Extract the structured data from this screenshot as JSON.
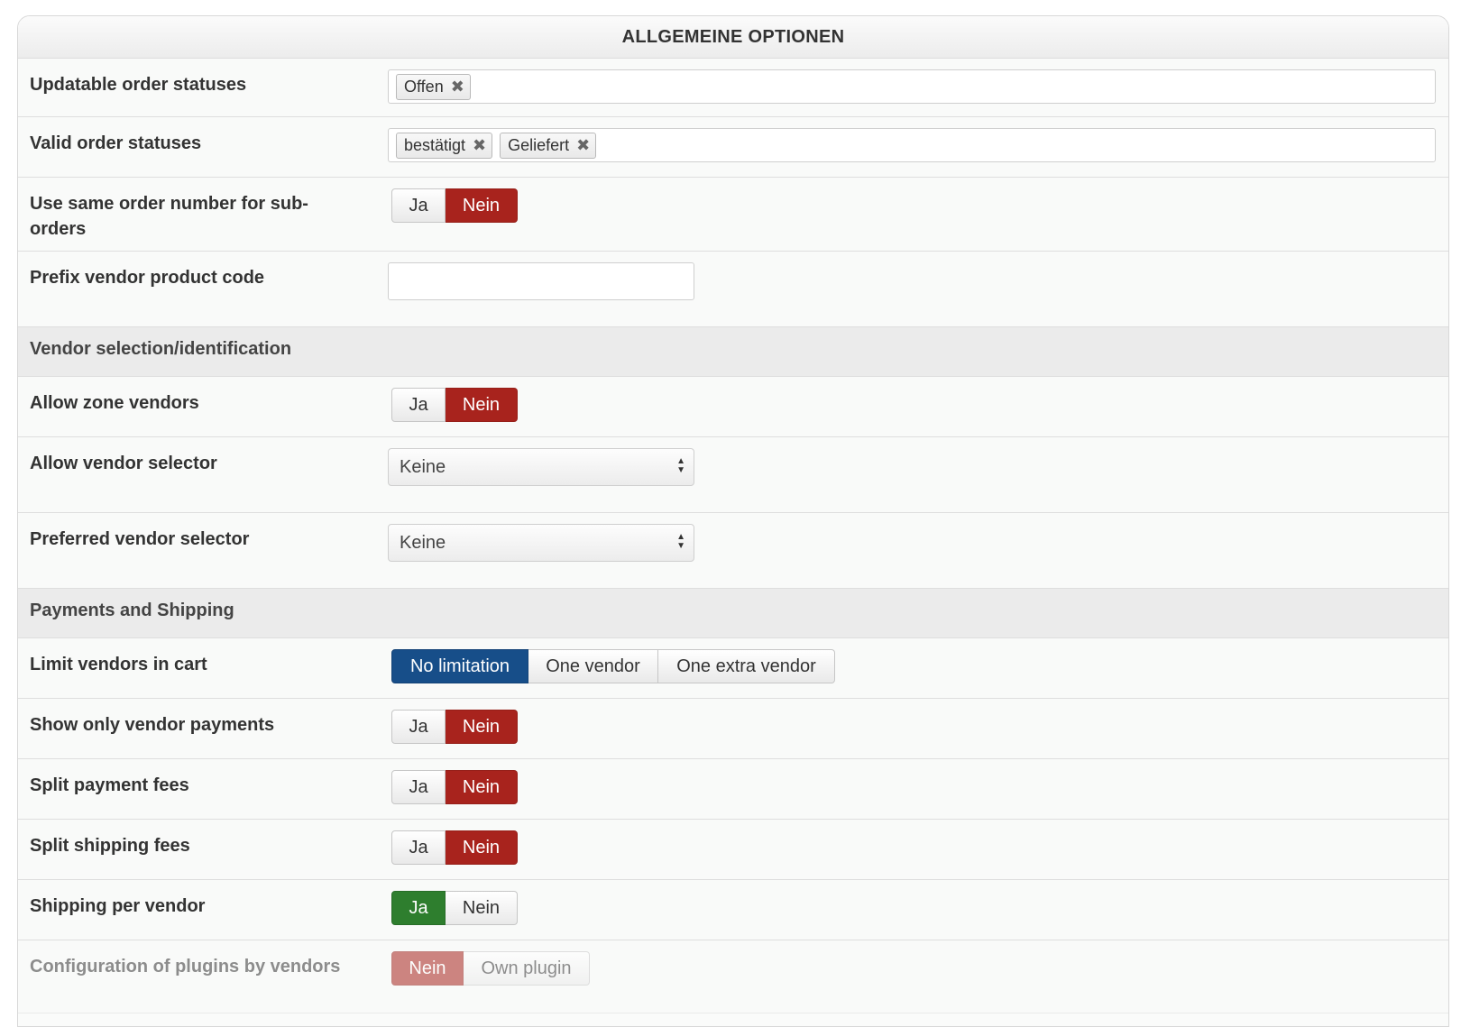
{
  "header": {
    "title": "ALLGEMEINE OPTIONEN"
  },
  "rows": {
    "updatable": {
      "label": "Updatable order statuses",
      "chips": [
        "Offen"
      ]
    },
    "valid": {
      "label": "Valid order statuses",
      "chips": [
        "bestätigt",
        "Geliefert"
      ]
    },
    "same_order_number": {
      "label": "Use same order number for sub-orders",
      "yes": "Ja",
      "no": "Nein",
      "selected": "Nein"
    },
    "prefix_code": {
      "label": "Prefix vendor product code",
      "value": ""
    },
    "allow_zone_vendors": {
      "label": "Allow zone vendors",
      "yes": "Ja",
      "no": "Nein",
      "selected": "Nein"
    },
    "allow_vendor_selector": {
      "label": "Allow vendor selector",
      "value": "Keine"
    },
    "preferred_vendor_selector": {
      "label": "Preferred vendor selector",
      "value": "Keine"
    },
    "limit_vendors": {
      "label": "Limit vendors in cart",
      "options": [
        "No limitation",
        "One vendor",
        "One extra vendor"
      ],
      "selected": "No limitation"
    },
    "show_vendor_payments": {
      "label": "Show only vendor payments",
      "yes": "Ja",
      "no": "Nein",
      "selected": "Nein"
    },
    "split_payment_fees": {
      "label": "Split payment fees",
      "yes": "Ja",
      "no": "Nein",
      "selected": "Nein"
    },
    "split_shipping_fees": {
      "label": "Split shipping fees",
      "yes": "Ja",
      "no": "Nein",
      "selected": "Nein"
    },
    "shipping_per_vendor": {
      "label": "Shipping per vendor",
      "yes": "Ja",
      "no": "Nein",
      "selected": "Ja"
    },
    "config_plugins": {
      "label": "Configuration of plugins by vendors",
      "options": [
        "Nein",
        "Own plugin"
      ],
      "selected": "Nein"
    }
  },
  "sections": {
    "vendor_selection": "Vendor selection/identification",
    "payments_shipping": "Payments and Shipping"
  },
  "select_arrows": {
    "up": "▲",
    "down": "▼"
  },
  "chip_remove_glyph": "✖",
  "colors": {
    "red": "#a8231d",
    "green": "#2e7e2e",
    "blue": "#174e89"
  }
}
